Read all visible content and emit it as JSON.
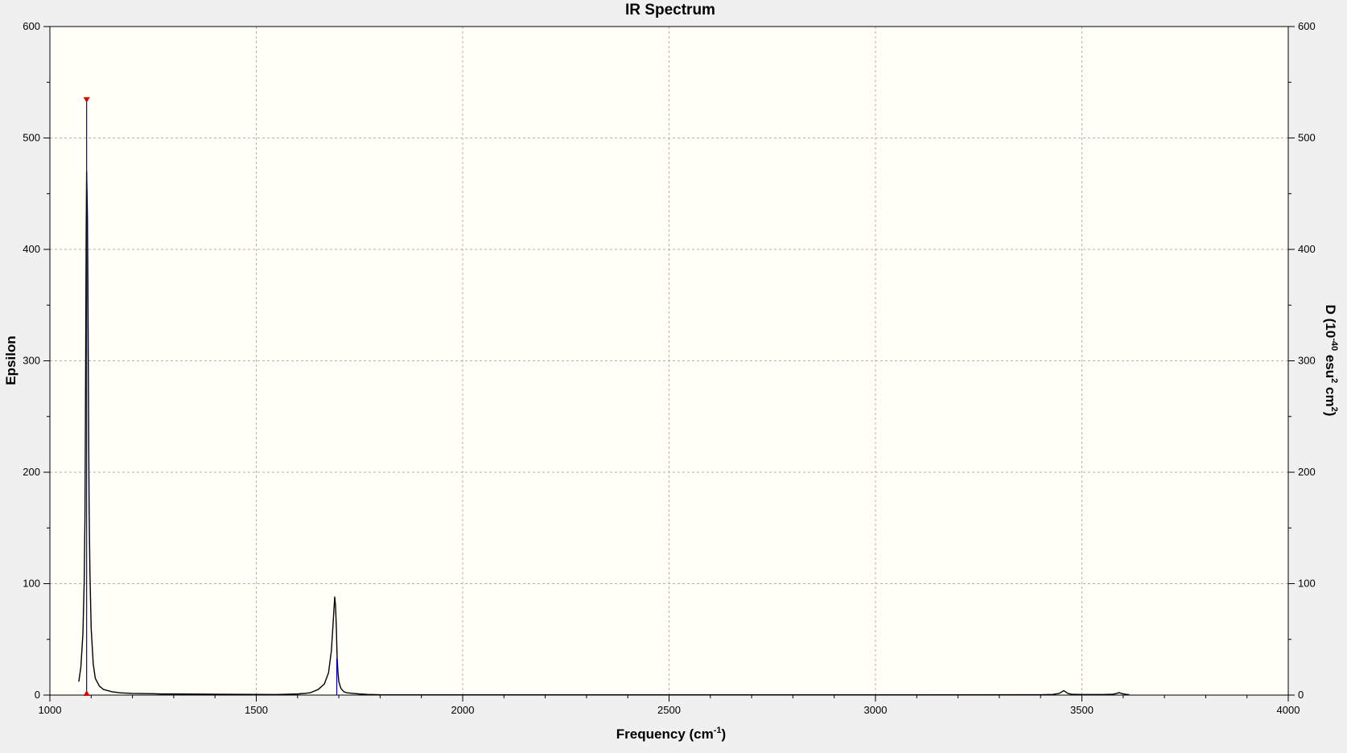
{
  "chart_data": {
    "type": "line",
    "title": "IR Spectrum",
    "xlabel": {
      "base": "Frequency (cm",
      "sup": "-1",
      "tail": ")"
    },
    "ylabel_left": "Epsilon",
    "ylabel_right": {
      "p1": "D (10",
      "sup1": "-40",
      "p2": " esu",
      "sup2": "2",
      "p3": " cm",
      "sup3": "2",
      "p4": ")"
    },
    "xlim": [
      1000,
      4000
    ],
    "ylim_left": [
      0,
      600
    ],
    "ylim_right": [
      0,
      600
    ],
    "x_ticks": [
      "1000",
      "1500",
      "2000",
      "2500",
      "3000",
      "3500",
      "4000"
    ],
    "y_ticks_left": [
      "0",
      "100",
      "200",
      "300",
      "400",
      "500",
      "600"
    ],
    "y_ticks_right": [
      "0",
      "100",
      "200",
      "300",
      "400",
      "500",
      "600"
    ],
    "grid": true,
    "colors": {
      "plot_background": "#fffff8",
      "spectrum_line": "#000000",
      "stick_line": "#0000cc",
      "marker": "#dd0000",
      "grid": "#b0b0b0"
    },
    "series": [
      {
        "x": [
          1070,
          1075,
          1080,
          1083,
          1085,
          1086,
          1087,
          1088,
          1089,
          1090,
          1091,
          1092,
          1093,
          1094,
          1095,
          1097,
          1100,
          1105,
          1110,
          1120,
          1130,
          1150,
          1170,
          1200,
          1250,
          1270,
          1300,
          1400,
          1500,
          1550,
          1600,
          1630,
          1650,
          1665,
          1675,
          1682,
          1687,
          1690,
          1692,
          1694,
          1695,
          1696,
          1698,
          1700,
          1705,
          1712,
          1720,
          1735,
          1750,
          1770,
          1800,
          1900,
          2000,
          2500,
          3000,
          3400,
          3430,
          3445,
          3452,
          3456,
          3460,
          3466,
          3475,
          3500,
          3550,
          3575,
          3585,
          3590,
          3596,
          3605,
          3615
        ],
        "y": [
          12,
          25,
          55,
          100,
          160,
          240,
          330,
          420,
          470,
          450,
          428,
          370,
          300,
          230,
          170,
          110,
          60,
          28,
          15,
          8,
          5,
          3,
          2,
          1.5,
          1.2,
          1,
          1,
          0.8,
          0.6,
          0.5,
          1,
          2,
          5,
          10,
          20,
          40,
          70,
          88,
          80,
          60,
          45,
          32,
          20,
          12,
          6,
          3,
          2,
          1.5,
          1,
          0.6,
          0.3,
          0.2,
          0.2,
          0.2,
          0.2,
          0.3,
          0.6,
          1.5,
          3,
          4,
          3,
          1.5,
          0.8,
          0.5,
          0.5,
          0.8,
          1.5,
          2.2,
          1.5,
          0.8,
          0.3
        ]
      }
    ],
    "sticks": [
      {
        "x": 1089,
        "y": 533
      },
      {
        "x": 1695,
        "y": 33
      }
    ]
  }
}
